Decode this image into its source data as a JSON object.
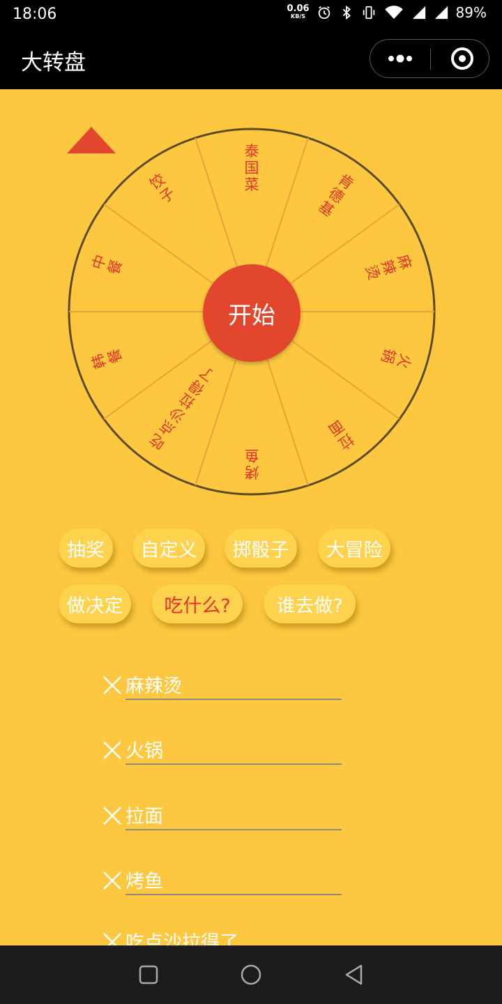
{
  "status": {
    "time": "18:06",
    "net_speed": "0.06",
    "net_unit": "KB/S",
    "battery": "89%"
  },
  "nav": {
    "title": "大转盘"
  },
  "wheel": {
    "segments": [
      "泰国菜",
      "肯德基",
      "麻辣烫",
      "火锅",
      "拉面",
      "烤鱼",
      "吃点沙拉得了",
      "韩餐",
      "中餐",
      "饺子"
    ],
    "start_label": "开始",
    "colors": {
      "segment": "#fdc83f",
      "divider": "#e8a23a",
      "rim": "#5a4a20",
      "text": "#e0332a",
      "button": "#e2462c"
    }
  },
  "chips": [
    {
      "label": "抽奖",
      "active": false
    },
    {
      "label": "自定义",
      "active": false
    },
    {
      "label": "掷骰子",
      "active": false
    },
    {
      "label": "大冒险",
      "active": false
    },
    {
      "label": "做决定",
      "active": false
    },
    {
      "label": "吃什么?",
      "active": true
    },
    {
      "label": "谁去做?",
      "active": false
    }
  ],
  "items": [
    "麻辣烫",
    "火锅",
    "拉面",
    "烤鱼",
    "吃点沙拉得了"
  ]
}
